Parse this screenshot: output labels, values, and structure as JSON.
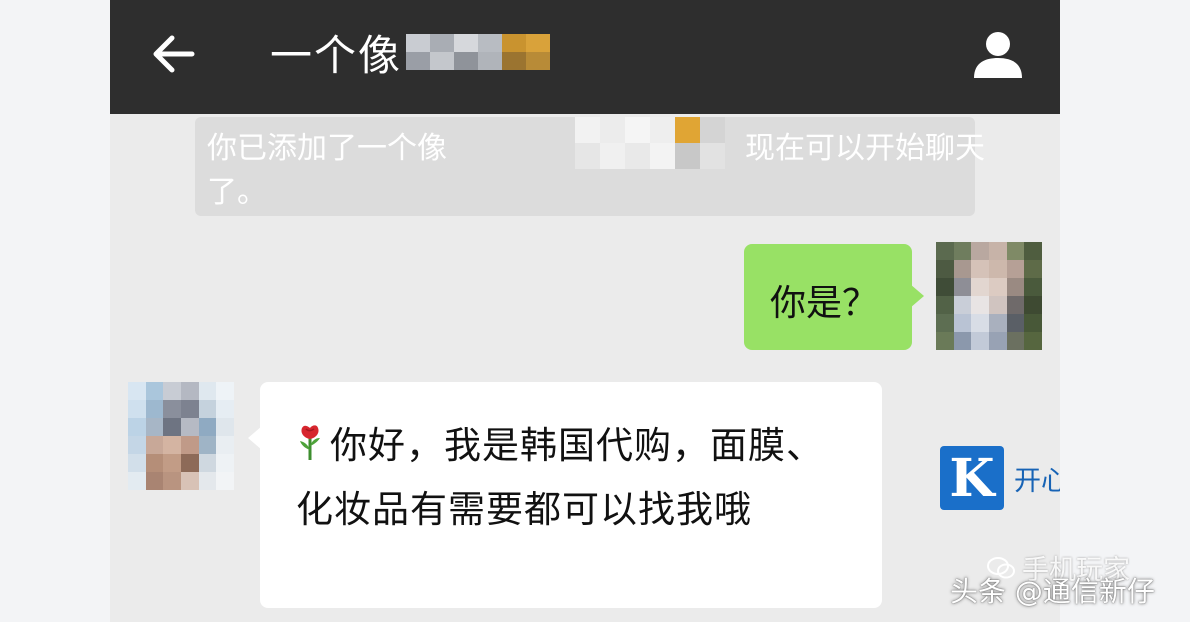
{
  "header": {
    "back_icon": "arrow-left-icon",
    "title": "一个像",
    "profile_icon": "person-icon"
  },
  "system_notice": {
    "line1_prefix": "你已添加了一个像",
    "line1_suffix": "现在可以开始聊天",
    "line2": "了。"
  },
  "messages": [
    {
      "side": "right",
      "text": "你是？",
      "bubble_color": "#98e165"
    },
    {
      "side": "left",
      "emoji": "rose-icon",
      "text": "你好，我是韩国代购，面膜、化妆品有需要都可以找我哦",
      "bubble_color": "#ffffff"
    }
  ],
  "watermarks": {
    "logo_letter": "K",
    "brand_text": "开心手机恢复大师",
    "channel_text": "手机玩家",
    "source_text": "头条 @通信新仔"
  },
  "colors": {
    "header_bg": "#2e2e2e",
    "chat_bg": "#ebebeb",
    "sent_bubble": "#98e165",
    "received_bubble": "#ffffff",
    "brand_blue": "#1a6fc9"
  }
}
